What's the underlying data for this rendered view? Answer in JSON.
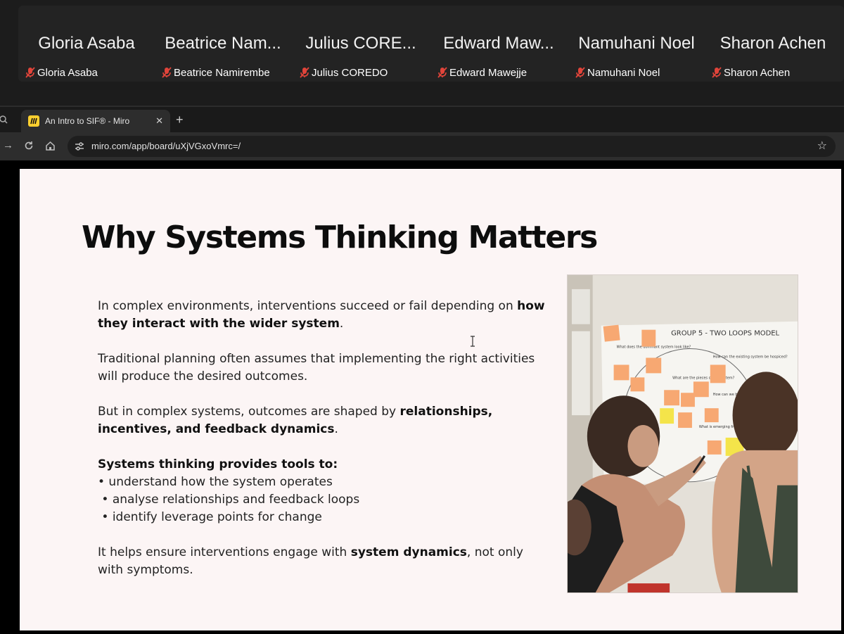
{
  "participants": [
    {
      "display_name": "Gloria Asaba",
      "label": "Gloria Asaba"
    },
    {
      "display_name": "Beatrice Nam...",
      "label": "Beatrice Namirembe"
    },
    {
      "display_name": "Julius CORE...",
      "label": "Julius COREDO"
    },
    {
      "display_name": "Edward Maw...",
      "label": "Edward Mawejje"
    },
    {
      "display_name": "Namuhani Noel",
      "label": "Namuhani Noel"
    },
    {
      "display_name": "Sharon Achen",
      "label": "Sharon Achen"
    }
  ],
  "colors": {
    "mic_muted": "#e0443a",
    "tab_favicon": "#ffd02f",
    "sticky_orange": "#f7a872",
    "sticky_yellow": "#f4e44a"
  },
  "browser": {
    "tab_title": "An Intro to SIF® - Miro",
    "url": "miro.com/app/board/uXjVGxoVmrc=/"
  },
  "slide": {
    "title": "Why Systems Thinking Matters",
    "p1_text": "In complex environments, interventions succeed or fail depending on ",
    "p1_bold": "how they interact with the wider system",
    "p1_end": ".",
    "p2_text": "Traditional planning often assumes that implementing the right activities will produce the desired outcomes.",
    "p3_text": "But in complex systems, outcomes are shaped by ",
    "p3_bold": "relationships, incentives, and feedback dynamics",
    "p3_end": ".",
    "tools_heading": "Systems thinking provides tools to:",
    "bullets": [
      "• understand how the system operates",
      " • analyse relationships and feedback loops",
      " • identify leverage points for change"
    ],
    "p5_text": "It helps ensure interventions engage with ",
    "p5_bold": "system dynamics",
    "p5_end": ", not only with symptoms."
  },
  "photo": {
    "poster_title": "GROUP 5 - TWO LOOPS MODEL",
    "q1": "What does the dominant system look like?",
    "q2": "What are the pieces of the system?",
    "q3": "How can the existing system be hospiced?",
    "q4": "How can we bridge the old and the new?",
    "q5": "What is emerging from the pockets of the future?"
  }
}
